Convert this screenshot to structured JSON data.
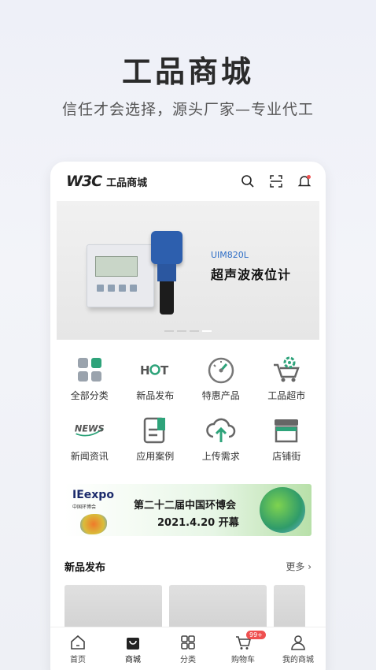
{
  "hero": {
    "title": "工品商城",
    "subtitle": "信任才会选择，源头厂家—专业代工"
  },
  "header": {
    "logo": "W3C",
    "app_name": "工品商城",
    "icons": [
      "search-icon",
      "scan-icon",
      "bell-icon"
    ]
  },
  "banner": {
    "model": "UIM820L",
    "product_name": "超声波液位计",
    "slide_count": 4,
    "active_slide": 4
  },
  "categories": [
    {
      "label": "全部分类",
      "icon": "grid-icon"
    },
    {
      "label": "新品发布",
      "icon": "hot-icon"
    },
    {
      "label": "特惠产品",
      "icon": "gauge-icon"
    },
    {
      "label": "工品超市",
      "icon": "cart-icon"
    },
    {
      "label": "新闻资讯",
      "icon": "news-icon"
    },
    {
      "label": "应用案例",
      "icon": "document-icon"
    },
    {
      "label": "上传需求",
      "icon": "cloud-upload-icon"
    },
    {
      "label": "店铺街",
      "icon": "store-icon"
    }
  ],
  "ad": {
    "brand": "IEexpo",
    "brand_sub": "中国环博会",
    "title": "第二十二届中国环博会",
    "date": "2021.4.20 开幕"
  },
  "new_products": {
    "title": "新品发布",
    "more": "更多"
  },
  "tabbar": [
    {
      "label": "首页",
      "icon": "home-icon"
    },
    {
      "label": "商城",
      "icon": "bag-icon"
    },
    {
      "label": "分类",
      "icon": "category-icon"
    },
    {
      "label": "购物车",
      "icon": "cart-icon",
      "badge": "99+"
    },
    {
      "label": "我的商城",
      "icon": "user-icon"
    }
  ],
  "colors": {
    "accent": "#2f6ec6",
    "badge": "#ef5050"
  }
}
